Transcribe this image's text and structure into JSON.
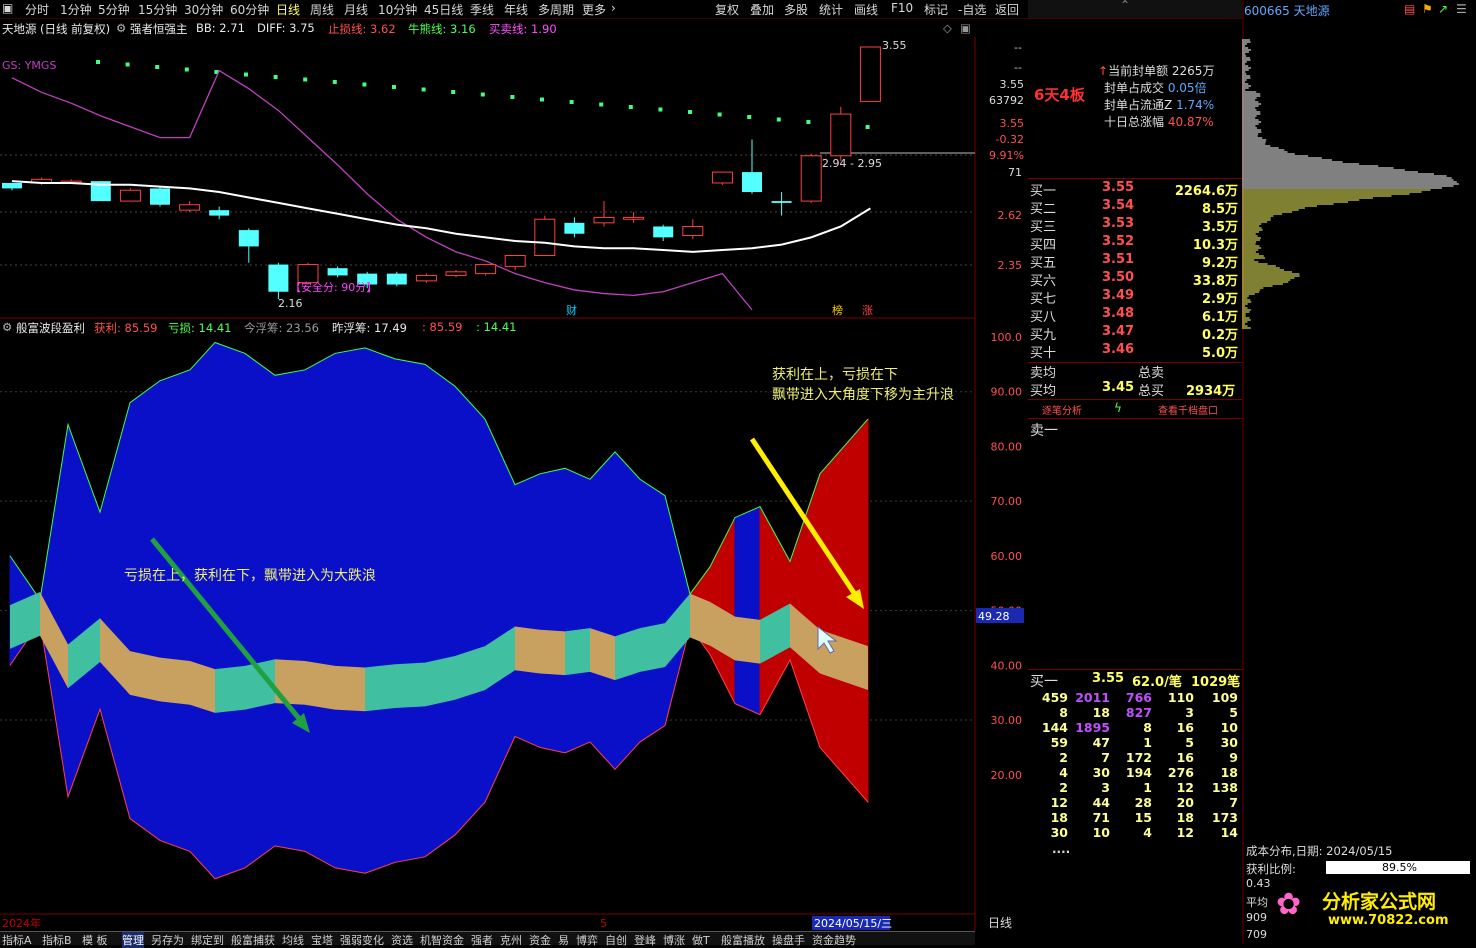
{
  "toolbar": {
    "periods": [
      "分时",
      "1分钟",
      "5分钟",
      "15分钟",
      "30分钟",
      "60分钟",
      "日线",
      "周线",
      "月线",
      "10分钟",
      "45日线",
      "季线",
      "年线",
      "多周期",
      "更多"
    ],
    "active_period": "日线",
    "tools": [
      "复权",
      "叠加",
      "多股",
      "统计",
      "画线",
      "F10",
      "标记",
      "-自选",
      "返回"
    ]
  },
  "main_title": {
    "stock": "天地源",
    "mode": "(日线 前复权)",
    "indicator_name": "强者恒强主",
    "bb": "BB: 2.71",
    "diff": "DIFF: 3.75",
    "stop_loss": "止损线: 3.62",
    "bull": "牛熊线: 3.16",
    "buysell": "买卖线: 1.90",
    "gs_label": "GS: YMGS"
  },
  "main_chart": {
    "high_label": "3.55",
    "low_label": "2.16",
    "range_label": "2.94 - 2.95",
    "safety_label": "【安全分: 90分】",
    "marker_cai": "财",
    "marker_bang": "榜",
    "marker_zhang": "涨",
    "right_axis": [
      "--",
      "--",
      "3.55",
      "63792",
      "3.55",
      "-0.32",
      "9.91%",
      "71",
      "2.62",
      "2.35"
    ],
    "candles": [
      {
        "o": 2.8,
        "c": 2.77,
        "h": 2.8,
        "l": 2.76
      },
      {
        "o": 2.8,
        "c": 2.82,
        "h": 2.83,
        "l": 2.79
      },
      {
        "o": 2.81,
        "c": 2.81,
        "h": 2.82,
        "l": 2.8
      },
      {
        "o": 2.81,
        "c": 2.7,
        "h": 2.81,
        "l": 2.7
      },
      {
        "o": 2.7,
        "c": 2.76,
        "h": 2.77,
        "l": 2.7
      },
      {
        "o": 2.77,
        "c": 2.68,
        "h": 2.78,
        "l": 2.67
      },
      {
        "o": 2.65,
        "c": 2.68,
        "h": 2.7,
        "l": 2.64
      },
      {
        "o": 2.65,
        "c": 2.62,
        "h": 2.67,
        "l": 2.6
      },
      {
        "o": 2.54,
        "c": 2.45,
        "h": 2.55,
        "l": 2.36
      },
      {
        "o": 2.35,
        "c": 2.2,
        "h": 2.36,
        "l": 2.16
      },
      {
        "o": 2.25,
        "c": 2.35,
        "h": 2.36,
        "l": 2.24
      },
      {
        "o": 2.33,
        "c": 2.29,
        "h": 2.34,
        "l": 2.28
      },
      {
        "o": 2.3,
        "c": 2.24,
        "h": 2.31,
        "l": 2.22
      },
      {
        "o": 2.3,
        "c": 2.24,
        "h": 2.31,
        "l": 2.23
      },
      {
        "o": 2.26,
        "c": 2.29,
        "h": 2.3,
        "l": 2.25
      },
      {
        "o": 2.29,
        "c": 2.31,
        "h": 2.32,
        "l": 2.28
      },
      {
        "o": 2.3,
        "c": 2.35,
        "h": 2.35,
        "l": 2.29
      },
      {
        "o": 2.34,
        "c": 2.4,
        "h": 2.4,
        "l": 2.32
      },
      {
        "o": 2.4,
        "c": 2.6,
        "h": 2.62,
        "l": 2.4
      },
      {
        "o": 2.58,
        "c": 2.52,
        "h": 2.61,
        "l": 2.5
      },
      {
        "o": 2.58,
        "c": 2.61,
        "h": 2.7,
        "l": 2.56
      },
      {
        "o": 2.6,
        "c": 2.61,
        "h": 2.64,
        "l": 2.58
      },
      {
        "o": 2.56,
        "c": 2.5,
        "h": 2.57,
        "l": 2.48
      },
      {
        "o": 2.51,
        "c": 2.56,
        "h": 2.6,
        "l": 2.49
      },
      {
        "o": 2.8,
        "c": 2.86,
        "h": 2.86,
        "l": 2.79
      },
      {
        "o": 2.86,
        "c": 2.75,
        "h": 3.04,
        "l": 2.74
      },
      {
        "o": 2.7,
        "c": 2.69,
        "h": 2.75,
        "l": 2.62
      },
      {
        "o": 2.7,
        "c": 2.95,
        "h": 2.96,
        "l": 2.69
      },
      {
        "o": 2.95,
        "c": 3.18,
        "h": 3.22,
        "l": 2.92
      },
      {
        "o": 3.25,
        "c": 3.55,
        "h": 3.55,
        "l": 3.25
      }
    ],
    "ma": [
      2.81,
      2.8,
      2.8,
      2.79,
      2.79,
      2.78,
      2.77,
      2.75,
      2.72,
      2.69,
      2.66,
      2.63,
      2.6,
      2.57,
      2.55,
      2.52,
      2.5,
      2.48,
      2.47,
      2.45,
      2.44,
      2.44,
      2.43,
      2.42,
      2.43,
      2.44,
      2.46,
      2.5,
      2.56,
      2.66
    ],
    "purple": [
      3.38,
      3.3,
      3.24,
      3.17,
      3.11,
      3.05,
      3.05,
      3.42,
      3.32,
      3.2,
      3.05,
      2.9,
      2.74,
      2.6,
      2.5,
      2.42,
      2.37,
      2.3,
      2.25,
      2.21,
      2.19,
      2.18,
      2.2,
      2.25,
      2.3,
      2.1
    ]
  },
  "ind_title": {
    "name": "般富波段盈利",
    "profit": "获利: 85.59",
    "loss": "亏损: 14.41",
    "today": "今浮筹: 23.56",
    "yesterday": "昨浮筹: 17.49",
    "v1": ": 85.59",
    "v2": ": 14.41"
  },
  "ind_chart": {
    "y_axis": [
      "100.0",
      "90.00",
      "80.00",
      "70.00",
      "60.00",
      "50.00",
      "40.00",
      "30.00",
      "20.00"
    ],
    "current": "49.28",
    "annot_left": "亏损在上，获利在下，飘带进入为大跌浪",
    "annot_right_1": "获利在上，亏损在下",
    "annot_right_2": "飘带进入大角度下移为主升浪",
    "chart_data": {
      "type": "area",
      "x": [
        0,
        1,
        2,
        3,
        4,
        5,
        6,
        7,
        8,
        9,
        10,
        11,
        12,
        13,
        14,
        15,
        16,
        17,
        17.5,
        18,
        19,
        20,
        21,
        22,
        23,
        24,
        25,
        26,
        27,
        28,
        29
      ],
      "series": [
        {
          "name": "获利",
          "values": [
            60,
            52,
            84,
            68,
            88,
            92,
            94,
            99,
            97,
            93,
            94,
            97,
            98,
            96,
            95,
            91,
            85,
            73,
            75,
            76,
            74,
            79,
            74,
            71,
            53,
            58,
            67,
            69,
            59,
            75,
            85
          ]
        },
        {
          "name": "亏损",
          "values": [
            40,
            48,
            16,
            32,
            12,
            8,
            6,
            1,
            3,
            7,
            6,
            3,
            2,
            4,
            5,
            9,
            15,
            27,
            25,
            24,
            26,
            21,
            26,
            29,
            47,
            42,
            33,
            31,
            41,
            25,
            15
          ]
        }
      ],
      "ylim": [
        0,
        100
      ]
    },
    "x_start_label": "2024年",
    "x_mid_label": "5",
    "x_date_label": "2024/05/15/三",
    "period_label": "日线"
  },
  "right_panel": {
    "code_name": "600665 天地源",
    "boards": "6天4板",
    "stats": [
      {
        "label": "当前封单额",
        "value": "2265万"
      },
      {
        "label": "封单占成交",
        "value": "0.05倍"
      },
      {
        "label": "封单占流通Z",
        "value": "1.74%"
      },
      {
        "label": "十日总涨幅",
        "value": "40.87%"
      }
    ],
    "bids": [
      {
        "label": "买一",
        "price": "3.55",
        "vol": "2264.6万"
      },
      {
        "label": "买二",
        "price": "3.54",
        "vol": "8.5万"
      },
      {
        "label": "买三",
        "price": "3.53",
        "vol": "3.5万"
      },
      {
        "label": "买四",
        "price": "3.52",
        "vol": "10.3万"
      },
      {
        "label": "买五",
        "price": "3.51",
        "vol": "9.2万"
      },
      {
        "label": "买六",
        "price": "3.50",
        "vol": "33.8万"
      },
      {
        "label": "买七",
        "price": "3.49",
        "vol": "2.9万"
      },
      {
        "label": "买八",
        "price": "3.48",
        "vol": "6.1万"
      },
      {
        "label": "买九",
        "price": "3.47",
        "vol": "0.2万"
      },
      {
        "label": "买十",
        "price": "3.46",
        "vol": "5.0万"
      }
    ],
    "sell_avg_label": "卖均",
    "total_sell_label": "总卖",
    "buy_avg_label": "买均",
    "buy_avg": "3.45",
    "total_buy_label": "总买",
    "total_buy": "2934万",
    "btn_analysis": "逐笔分析",
    "btn_thousand": "查看千档盘口",
    "sell1": "卖一",
    "queue_head": {
      "label": "买一",
      "price": "3.55",
      "per": "62.0/笔",
      "count": "1029笔"
    },
    "queue": [
      [
        "459",
        "2011",
        "766",
        "110",
        "109"
      ],
      [
        "8",
        "18",
        "827",
        "3",
        "5"
      ],
      [
        "144",
        "1895",
        "8",
        "16",
        "10"
      ],
      [
        "59",
        "47",
        "1",
        "5",
        "30"
      ],
      [
        "2",
        "7",
        "172",
        "16",
        "9"
      ],
      [
        "4",
        "30",
        "194",
        "276",
        "18"
      ],
      [
        "2",
        "3",
        "1",
        "12",
        "138"
      ],
      [
        "12",
        "44",
        "28",
        "20",
        "7"
      ],
      [
        "18",
        "71",
        "15",
        "18",
        "173"
      ],
      [
        "30",
        "10",
        "4",
        "12",
        "14"
      ]
    ],
    "queue_more": "....",
    "cost_date": "成本分布,日期: 2024/05/15",
    "profit_ratio_label": "获利比例:",
    "profit_ratio": "89.5%",
    "r1": "0.43",
    "r2": "平均",
    "r3": "909",
    "r4": "709",
    "watermark": "分析家公式网",
    "watermark_url": "www.70822.com"
  },
  "bottom_tabs": [
    "指标A",
    "指标B",
    "模 板",
    "管理",
    "另存为",
    "绑定到",
    "般富捕获",
    "均线",
    "宝塔",
    "强弱变化",
    "资选",
    "机智资金",
    "强者",
    "克州",
    "资金",
    "易",
    "博弈",
    "自创",
    "登峰",
    "博涨",
    "做T",
    "般富播放",
    "操盘手",
    "资金趋势"
  ],
  "active_tab": "管理"
}
